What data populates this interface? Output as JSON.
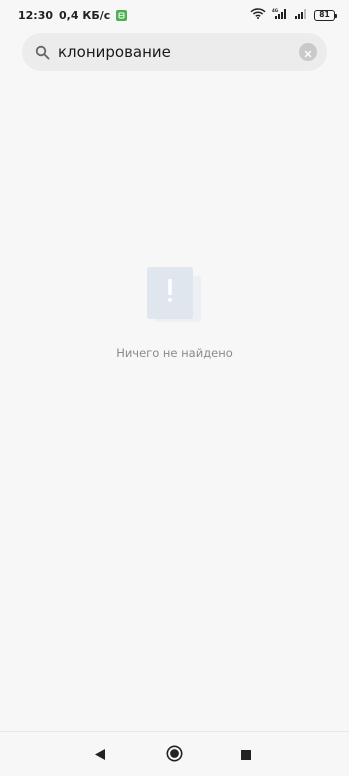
{
  "status_bar": {
    "time": "12:30",
    "speed": "0,4 КБ/с",
    "battery": "81",
    "icons": [
      "app-badge-icon",
      "wifi-icon",
      "signal-1-icon",
      "signal-2-icon",
      "battery-icon"
    ]
  },
  "search": {
    "value": "клонирование",
    "icon": "search-icon",
    "clear_icon": "clear-icon"
  },
  "empty_state": {
    "message": "Ничего не найдено",
    "icon": "exclamation-icon"
  },
  "navigation": {
    "buttons": [
      "back-icon",
      "home-icon",
      "recents-icon"
    ]
  },
  "colors": {
    "background": "#f7f7f7",
    "search_bg": "#ececec",
    "badge_green": "#4caf50",
    "illustration": "#dfe6ee",
    "muted_text": "#8a8a8a"
  }
}
